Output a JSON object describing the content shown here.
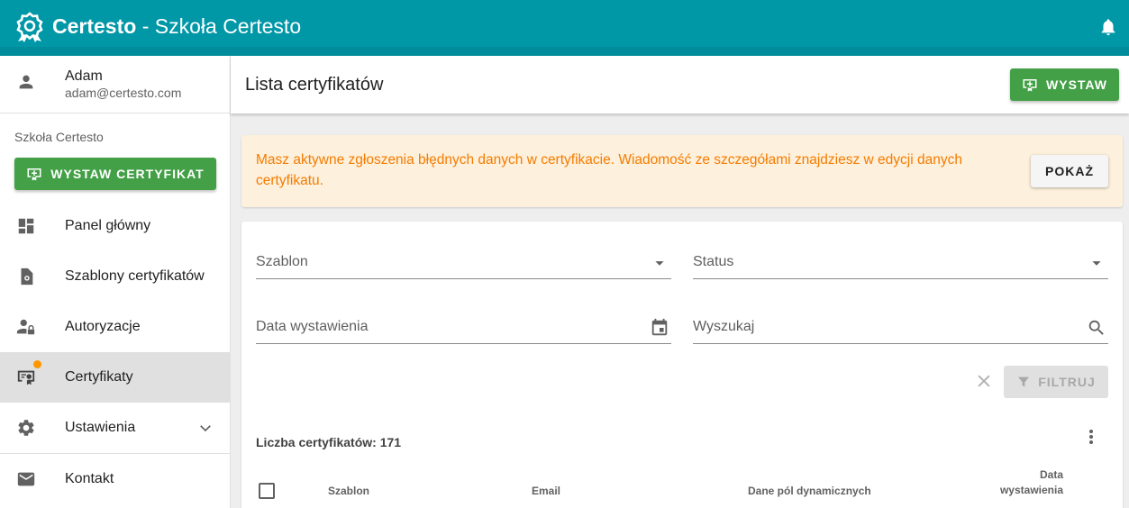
{
  "topbar": {
    "app_name": "Certesto",
    "separator": " - ",
    "org_name": "Szkoła Certesto",
    "logo_icon": "award-ribbon-icon",
    "bell_icon": "bell-icon",
    "color": "#0097a7"
  },
  "sidebar": {
    "user": {
      "name": "Adam",
      "email": "adam@certesto.com",
      "icon": "person-icon"
    },
    "school": "Szkoła Certesto",
    "issue_button": "WYSTAW CERTYFIKAT",
    "items": [
      {
        "label": "Panel główny",
        "icon": "dashboard-icon"
      },
      {
        "label": "Szablony certyfikatów",
        "icon": "template-icon"
      },
      {
        "label": "Autoryzacje",
        "icon": "person-lock-icon"
      },
      {
        "label": "Certyfikaty",
        "icon": "certificate-icon",
        "active": true,
        "badge_color": "#ff9800"
      },
      {
        "label": "Ustawienia",
        "icon": "gear-icon",
        "expandable": true
      },
      {
        "label": "Kontakt",
        "icon": "mail-icon"
      }
    ]
  },
  "header": {
    "title": "Lista certyfikatów",
    "issue_button": "WYSTAW"
  },
  "alert": {
    "text": "Masz aktywne zgłoszenia błędnych danych w certyfikacie. Wiadomość ze szczegółami znajdziesz w edycji danych certyfikatu.",
    "button": "POKAŻ",
    "color": "#f57c00"
  },
  "filters": {
    "template_label": "Szablon",
    "status_label": "Status",
    "date_label": "Data wystawienia",
    "search_label": "Wyszukaj",
    "filter_button": "FILTRUJ"
  },
  "list": {
    "count_label": "Liczba certyfikatów: 171",
    "columns": [
      "Szablon",
      "Email",
      "Dane pól dynamicznych",
      "Data wystawienia"
    ]
  },
  "colors": {
    "accent": "#0097a7",
    "primary_button": "#43a047",
    "warning_bg": "#fdf0dc"
  }
}
